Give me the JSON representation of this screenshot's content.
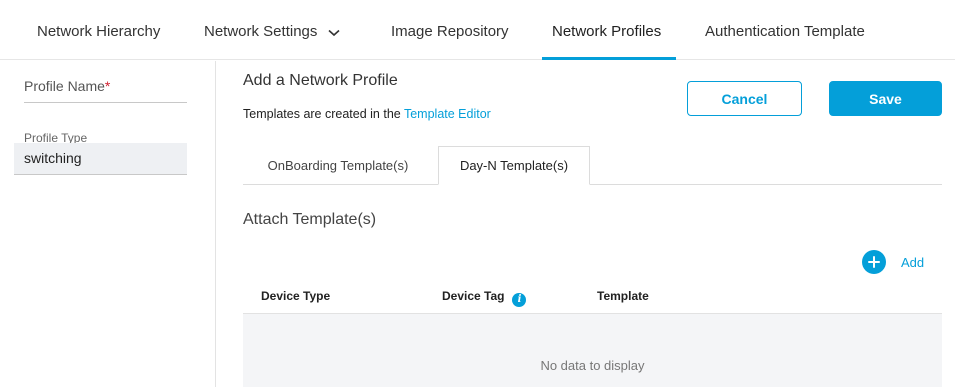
{
  "nav": {
    "tabs": [
      {
        "label": "Network Hierarchy"
      },
      {
        "label": "Network Settings"
      },
      {
        "label": "Image Repository"
      },
      {
        "label": "Network Profiles"
      },
      {
        "label": "Authentication Template"
      }
    ],
    "active": "Network Profiles"
  },
  "form": {
    "profile_name_label": "Profile Name",
    "required_marker": "*",
    "profile_name_value": "",
    "profile_type_label": "Profile Type",
    "profile_type_value": "switching"
  },
  "main": {
    "title": "Add a Network Profile",
    "subtitle_prefix": "Templates are created in the ",
    "subtitle_link": "Template Editor",
    "cancel_label": "Cancel",
    "save_label": "Save",
    "subtabs": [
      {
        "label": "OnBoarding Template(s)"
      },
      {
        "label": "Day-N Template(s)"
      }
    ],
    "active_subtab": "Day-N Template(s)",
    "section_title": "Attach Template(s)",
    "add_label": "Add",
    "table": {
      "columns": [
        "Device Type",
        "Device Tag",
        "Template"
      ],
      "empty_text": "No data to display"
    }
  },
  "colors": {
    "accent": "#049fd9",
    "required": "#cf2030"
  },
  "icons": {
    "settings_dropdown": "chevron-down-icon",
    "add": "plus-circle-icon",
    "device_tag_info": "info-icon"
  }
}
